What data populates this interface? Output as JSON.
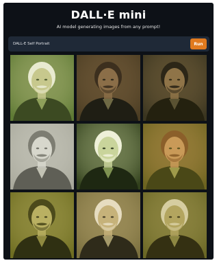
{
  "app": {
    "title": "DALL·E mini",
    "subtitle": "AI model generating images from any prompt!"
  },
  "prompt": {
    "value": "DALL-E Self Portrait",
    "run_label": "Run"
  },
  "colors": {
    "page_background": "#0d1117",
    "prompt_bar": "#1f2937",
    "run_button": "#e07a1f"
  },
  "results": [
    {
      "icon": "portrait-image",
      "palette": {
        "bg": "#5f7a35",
        "face": "#c7c88d",
        "hair": "#e8ead0",
        "coat": "#3c4a22",
        "shirt": "#8ea05a"
      }
    },
    {
      "icon": "portrait-image",
      "palette": {
        "bg": "#4b3d23",
        "face": "#8b6e48",
        "hair": "#3c2f1e",
        "coat": "#1f1e14",
        "shirt": "#6f6a45"
      }
    },
    {
      "icon": "portrait-image",
      "palette": {
        "bg": "#3a3520",
        "face": "#8f7448",
        "hair": "#2c2617",
        "coat": "#24210f",
        "shirt": "#5a5232"
      }
    },
    {
      "icon": "portrait-image",
      "palette": {
        "bg": "#a9a99c",
        "face": "#d7d7cc",
        "hair": "#7d7d72",
        "coat": "#5f5f56",
        "shirt": "#c2c2b4"
      }
    },
    {
      "icon": "portrait-image",
      "palette": {
        "bg": "#31401c",
        "face": "#c9d49b",
        "hair": "#eef0d8",
        "coat": "#1e2812",
        "shirt": "#7f9352"
      }
    },
    {
      "icon": "portrait-image",
      "palette": {
        "bg": "#6d6420",
        "face": "#c99a58",
        "hair": "#8b5f2a",
        "coat": "#4a4817",
        "shirt": "#9f9a4a"
      }
    },
    {
      "icon": "portrait-image",
      "palette": {
        "bg": "#6f6e22",
        "face": "#b9b062",
        "hair": "#4c4a1b",
        "coat": "#2f3012",
        "shirt": "#8f8a40"
      }
    },
    {
      "icon": "portrait-image",
      "palette": {
        "bg": "#7a6f3e",
        "face": "#c6b27a",
        "hair": "#e6dcc0",
        "coat": "#2f2b1a",
        "shirt": "#a59a6a"
      }
    },
    {
      "icon": "portrait-image",
      "palette": {
        "bg": "#6b6826",
        "face": "#b3a55f",
        "hair": "#d6cda0",
        "coat": "#343012",
        "shirt": "#8d8742"
      }
    }
  ]
}
